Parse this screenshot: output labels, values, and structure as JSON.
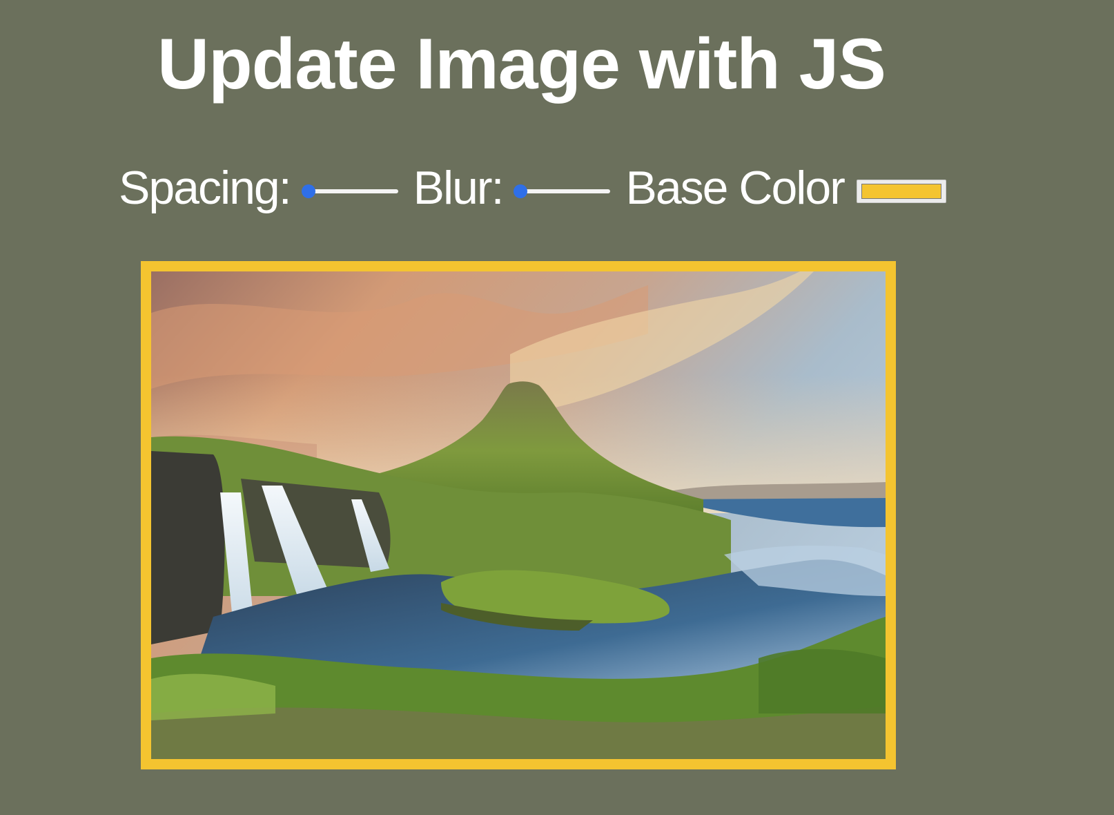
{
  "page": {
    "title": "Update Image with JS"
  },
  "controls": {
    "spacing": {
      "label": "Spacing:",
      "value": 0
    },
    "blur": {
      "label": "Blur:",
      "value": 0
    },
    "base_color": {
      "label": "Base Color",
      "value": "#f4c430"
    }
  },
  "image": {
    "description_icon": "landscape-photo",
    "frame_color": "#f4c430"
  },
  "colors": {
    "background": "#6b705c",
    "slider_accent": "#2f6fe8",
    "text": "#ffffff"
  }
}
